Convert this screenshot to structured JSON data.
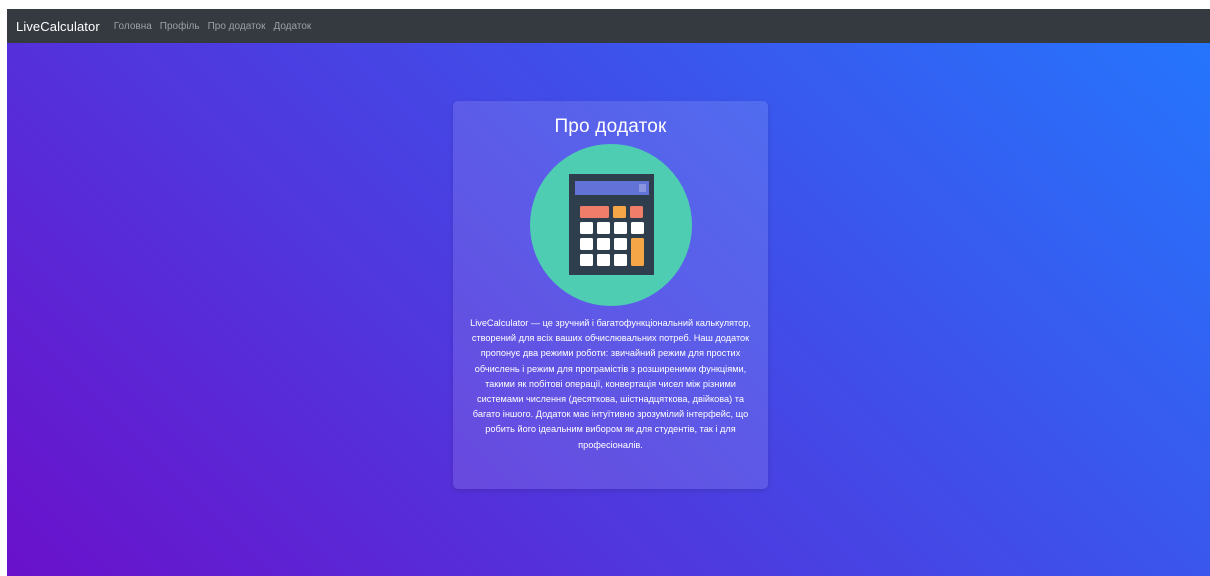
{
  "navbar": {
    "brand": "LiveCalculator",
    "links": [
      "Головна",
      "Профіль",
      "Про додаток",
      "Додаток"
    ]
  },
  "about": {
    "title": "Про додаток",
    "description": "LiveCalculator — це зручний і багатофункціональний калькулятор, створений для всіх ваших обчислювальних потреб. Наш додаток пропонує два режими роботи: звичайний режим для простих обчислень і режим для програмістів з розширеними функціями, такими як побітові операції, конвертація чисел між різними системами числення (десяткова, шістнадцяткова, двійкова) та багато іншого. Додаток має інтуїтивно зрозумілий інтерфейс, що робить його ідеальним вибором як для студентів, так і для професіоналів.",
    "illustration_icon": "calculator-icon"
  },
  "colors": {
    "navbar_bg": "#343a40",
    "gradient_start": "#6a11cb",
    "gradient_end": "#2575fc",
    "illustration_circle": "#4ecdb3"
  }
}
